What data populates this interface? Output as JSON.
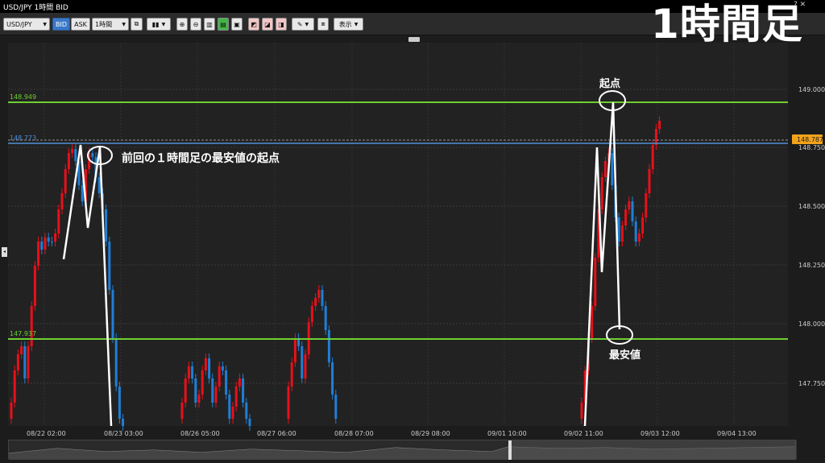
{
  "window": {
    "title": "USD/JPY 1時間 BID",
    "icons": "? ✕"
  },
  "overlay_title": "1時間足",
  "toolbar": {
    "symbol": "USD/JPY",
    "bid": "BID",
    "ask": "ASK",
    "timeframe": "1時間",
    "display": "表示"
  },
  "price_axis": {
    "ticks": [
      "149.000",
      "148.750",
      "148.500",
      "148.250",
      "148.000",
      "147.750"
    ],
    "current_price": "148.787"
  },
  "time_axis": {
    "ticks": [
      "08/22 02:00",
      "08/23 03:00",
      "08/26 05:00",
      "08/27 06:00",
      "08/28 07:00",
      "08/29 08:00",
      "09/01 10:00",
      "09/02 11:00",
      "09/03 12:00",
      "09/04 13:00"
    ]
  },
  "lines": {
    "upper_green": "148.949",
    "blue": "148.773",
    "lower_green": "147.937"
  },
  "annotations": {
    "previous_low_start": "前回の１時間足の最安値の起点",
    "start_point": "起点",
    "lowest": "最安値"
  },
  "colors": {
    "up": "#e8101a",
    "down": "#1f7fd6",
    "green_line": "#6ed030",
    "blue_line": "#4f8fd8",
    "price_tag": "#f2a31b"
  }
}
